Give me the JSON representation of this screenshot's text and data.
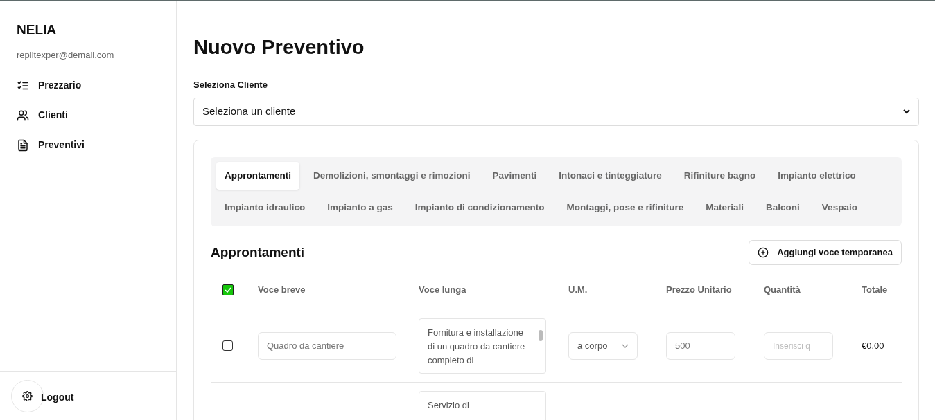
{
  "sidebar": {
    "brand": "NELIA",
    "email": "replitexper@demail.com",
    "items": [
      {
        "label": "Prezzario"
      },
      {
        "label": "Clienti"
      },
      {
        "label": "Preventivi"
      }
    ],
    "logout": "Logout"
  },
  "page": {
    "title": "Nuovo Preventivo",
    "client_label": "Seleziona Cliente",
    "client_select": "Seleziona un cliente"
  },
  "tabs": [
    {
      "label": "Approntamenti",
      "selected": true
    },
    {
      "label": "Demolizioni, smontaggi e rimozioni",
      "selected": false
    },
    {
      "label": "Pavimenti",
      "selected": false
    },
    {
      "label": "Intonaci e tinteggiature",
      "selected": false
    },
    {
      "label": "Rifiniture bagno",
      "selected": false
    },
    {
      "label": "Impianto elettrico",
      "selected": false
    },
    {
      "label": "Impianto idraulico",
      "selected": false
    },
    {
      "label": "Impianto a gas",
      "selected": false
    },
    {
      "label": "Impianto di condizionamento",
      "selected": false
    },
    {
      "label": "Montaggi, pose e rifiniture",
      "selected": false
    },
    {
      "label": "Materiali",
      "selected": false
    },
    {
      "label": "Balconi",
      "selected": false
    },
    {
      "label": "Vespaio",
      "selected": false
    }
  ],
  "section": {
    "title": "Approntamenti",
    "add_button": "Aggiungi voce temporanea"
  },
  "table": {
    "select_all_checked": true,
    "columns": [
      "Voce breve",
      "Voce lunga",
      "U.M.",
      "Prezzo Unitario",
      "Quantità",
      "Totale"
    ],
    "rows": [
      {
        "checked": false,
        "short_placeholder": "Quadro da cantiere",
        "long_text": "Fornitura e installazione di un quadro da cantiere completo di",
        "unit": "a corpo",
        "price_placeholder": "500",
        "quantity_placeholder": "Inserisci q",
        "total": "€0.00"
      },
      {
        "long_text": "Servizio di"
      }
    ]
  }
}
